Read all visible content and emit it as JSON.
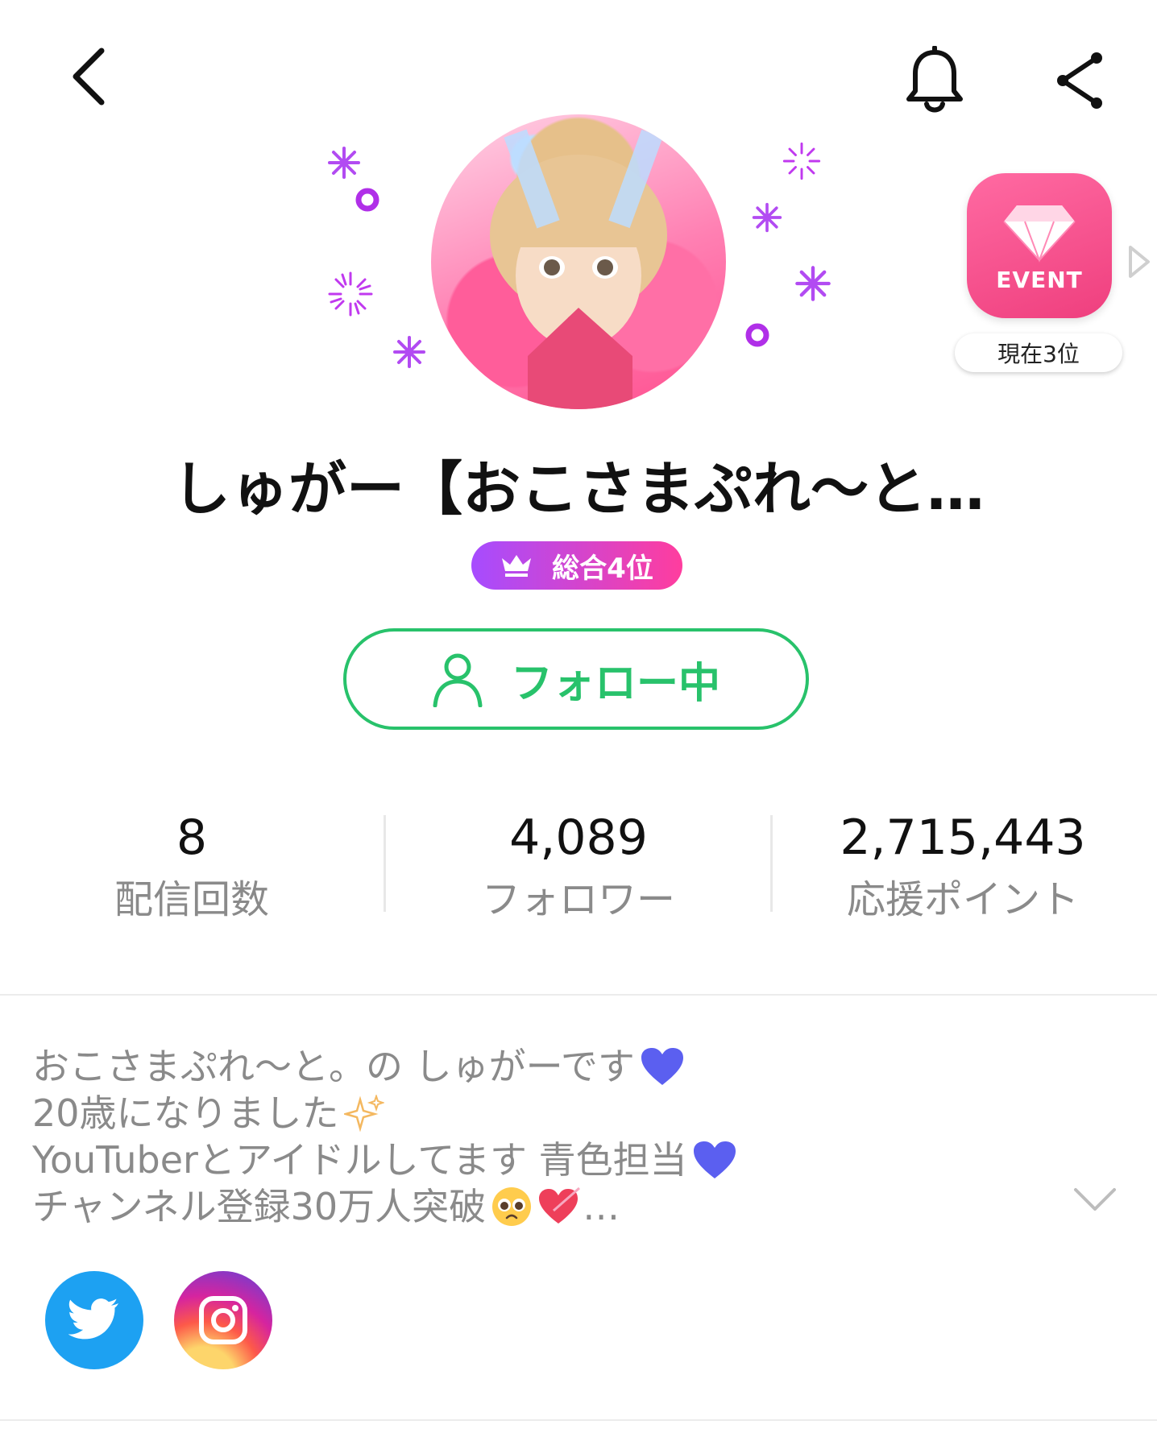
{
  "header": {
    "back_icon": "chevron-left-icon",
    "bell_icon": "bell-icon",
    "share_icon": "share-icon"
  },
  "profile": {
    "name": "しゅがー【おこさまぷれ〜と…",
    "rank_label": "総合4位",
    "follow_label": "フォロー中"
  },
  "event": {
    "label": "EVENT",
    "rank": "現在3位"
  },
  "stats": [
    {
      "value": "8",
      "label": "配信回数"
    },
    {
      "value": "4,089",
      "label": "フォロワー"
    },
    {
      "value": "2,715,443",
      "label": "応援ポイント"
    }
  ],
  "bio": {
    "line1": "おこさまぷれ〜と。の しゅがーです",
    "line2": "20歳になりました",
    "line3": "YouTuberとアイドルしてます 青色担当",
    "line4_a": "チャンネル登録30万人突破",
    "line4_b": "…"
  },
  "social": {
    "twitter_icon": "twitter-icon",
    "instagram_icon": "instagram-icon"
  },
  "colors": {
    "accent_green": "#28c26b",
    "event_pink": "#ef3f7e",
    "rank_gradient_start": "#a64cff",
    "rank_gradient_end": "#ff3d9e",
    "twitter_blue": "#1da1f2"
  }
}
